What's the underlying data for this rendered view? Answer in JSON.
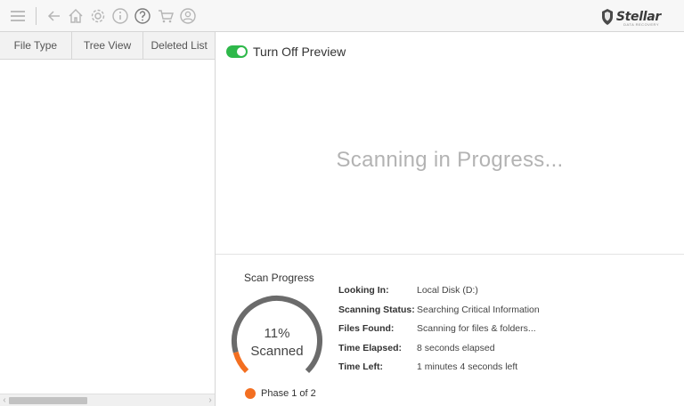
{
  "toolbar": {
    "icons": [
      "menu-icon",
      "back-arrow-icon",
      "home-icon",
      "settings-icon",
      "info-icon",
      "help-icon",
      "cart-icon",
      "account-icon"
    ],
    "brand": "Stellar",
    "brand_sub": "DATA RECOVERY"
  },
  "tabs": [
    "File Type",
    "Tree View",
    "Deleted List"
  ],
  "preview": {
    "label": "Turn Off Preview",
    "on": true,
    "color": "#2eb84a"
  },
  "status_message": "Scanning in Progress...",
  "scan_progress": {
    "title": "Scan Progress",
    "percent_text": "11%",
    "percent": 11,
    "scanned_label": "Scanned",
    "phase": "Phase 1 of 2",
    "accent": "#f36f21"
  },
  "info": [
    {
      "key": "Looking In:",
      "value": "Local Disk (D:)"
    },
    {
      "key": "Scanning Status:",
      "value": "Searching Critical Information"
    },
    {
      "key": "Files Found:",
      "value": "Scanning for files & folders..."
    },
    {
      "key": "Time Elapsed:",
      "value": "8 seconds elapsed"
    },
    {
      "key": "Time Left:",
      "value": "1 minutes 4 seconds left"
    }
  ]
}
